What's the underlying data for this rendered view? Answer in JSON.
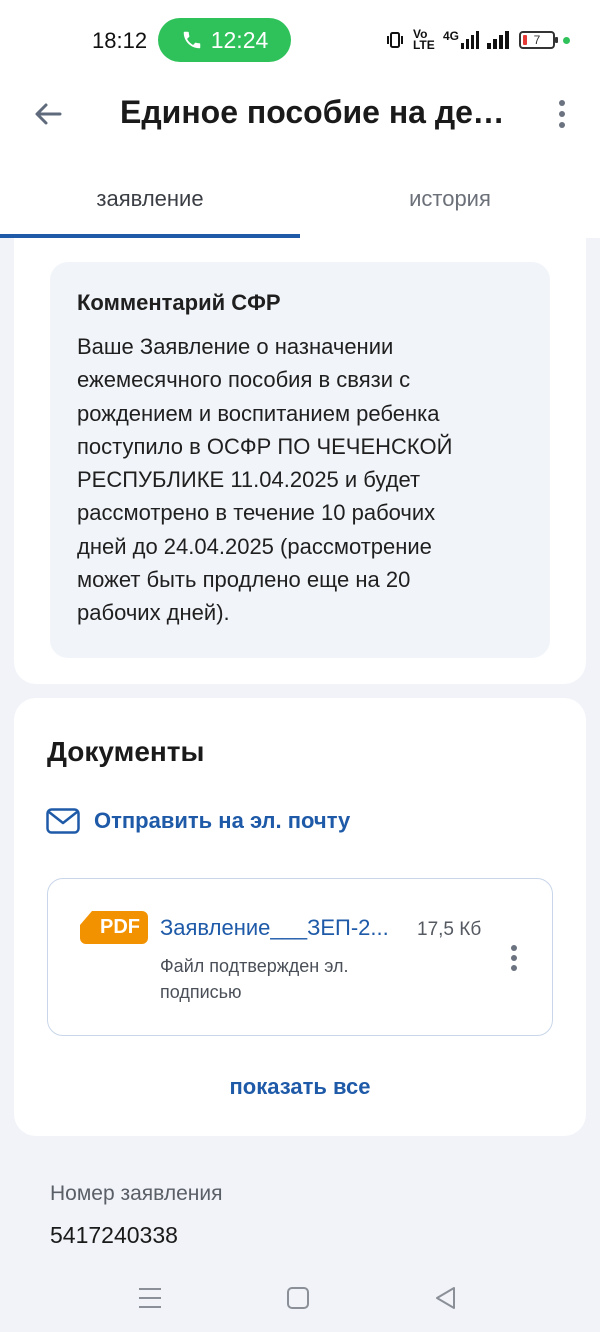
{
  "status_bar": {
    "time": "18:12",
    "call_timer": "12:24",
    "network_label": "4G",
    "volte_label": "Vo LTE",
    "battery_level": "7",
    "icons": [
      "vibrate-icon",
      "volte-icon",
      "signal-4g-icon",
      "signal-icon",
      "battery-icon"
    ]
  },
  "header": {
    "title": "Единое пособие на дет…",
    "back_icon": "arrow-left-icon",
    "more_icon": "more-vertical-icon"
  },
  "tabs": [
    {
      "label": "заявление",
      "active": true
    },
    {
      "label": "история",
      "active": false
    }
  ],
  "comment": {
    "title": "Комментарий СФР",
    "lines": [
      "Ваше Заявление о назначении",
      "ежемесячного пособия в связи с",
      "рождением и воспитанием ребенка",
      "поступило в ОСФР ПО ЧЕЧЕНСКОЙ",
      "РЕСПУБЛИКЕ 11.04.2025 и будет",
      "рассмотрено в течение 10 рабочих",
      "дней до 24.04.2025 (рассмотрение",
      "может быть продлено еще на 20",
      "рабочих дней)."
    ]
  },
  "documents": {
    "title": "Документы",
    "email_link": "Отправить на эл. почту",
    "files": [
      {
        "type_badge": "PDF",
        "name": "Заявление___ЗЕП-2...",
        "size": "17,5 Кб",
        "note_lines": [
          "Файл подтвержден эл.",
          "подписью"
        ]
      }
    ],
    "show_all": "показать все"
  },
  "application": {
    "number_label": "Номер заявления",
    "number_value": "5417240338"
  },
  "colors": {
    "accent_blue": "#1e5aa8",
    "call_green": "#2fc25b",
    "pdf_orange": "#f39200",
    "background": "#f1f3f8"
  }
}
